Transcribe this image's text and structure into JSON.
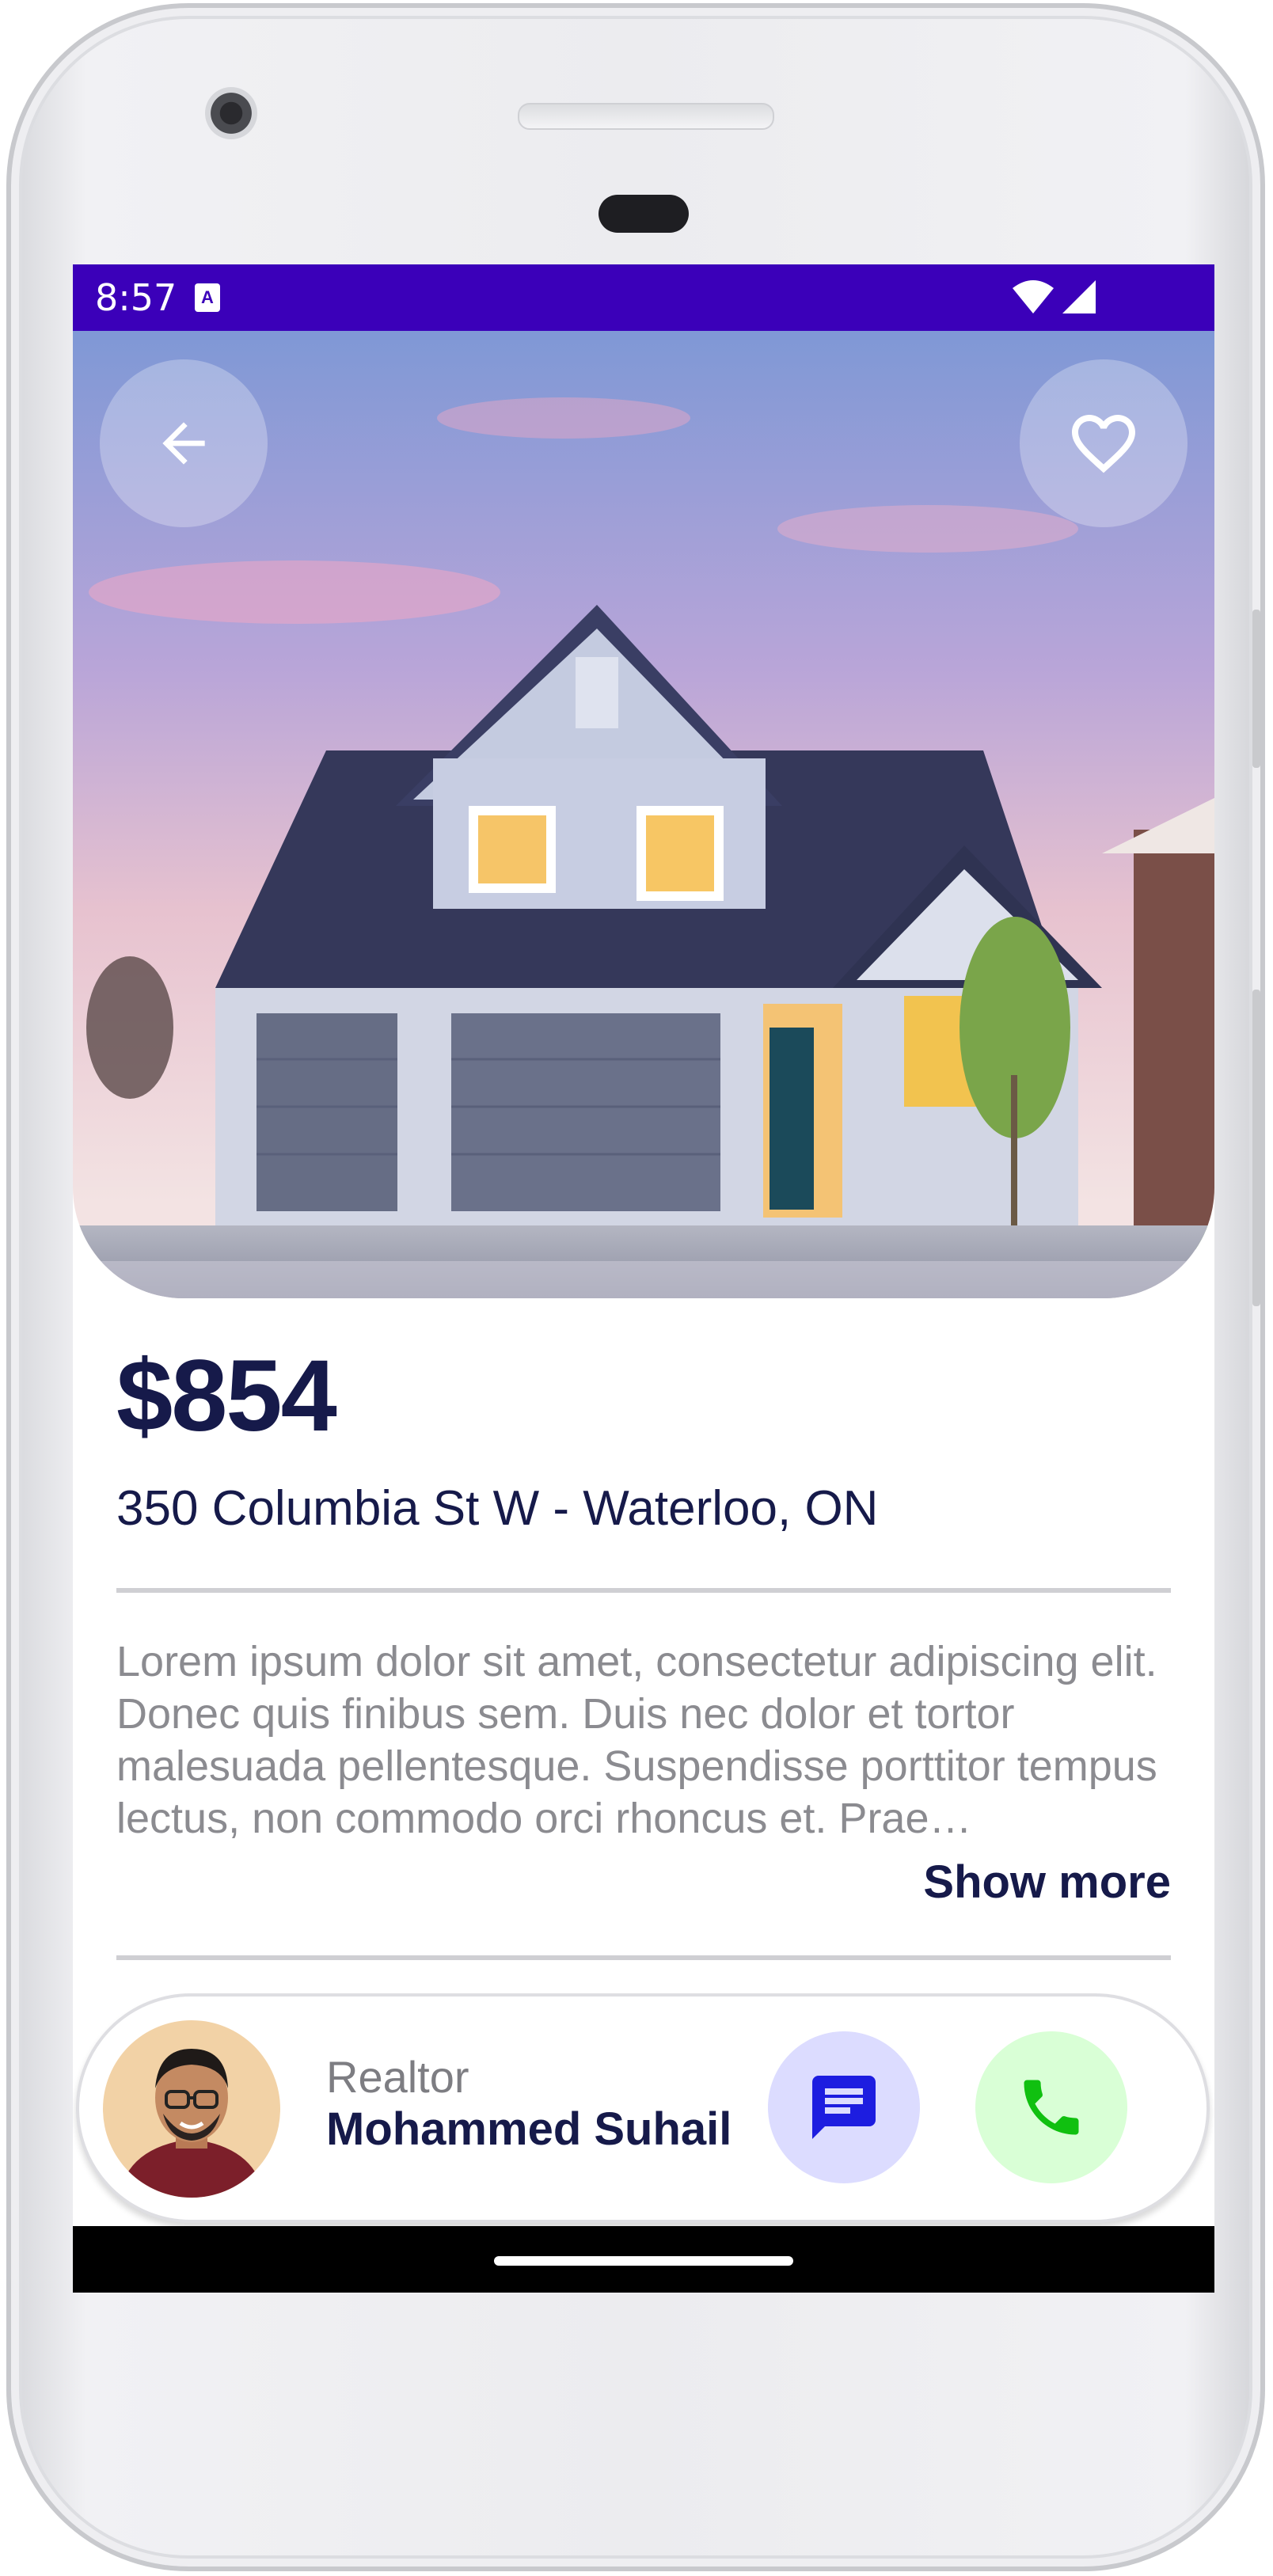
{
  "status_bar": {
    "time": "8:57",
    "background_color": "#3b00b9",
    "icons": [
      "accessibility-a-icon",
      "wifi-icon",
      "cell-signal-icon"
    ]
  },
  "hero": {
    "image_description_name": "house-photo",
    "back_icon": "arrow-left-icon",
    "favorite_icon": "heart-outline-icon"
  },
  "listing": {
    "price": "$854",
    "address": "350 Columbia St W - Waterloo, ON",
    "description": "Lorem ipsum dolor sit amet, consectetur adipiscing elit. Donec quis finibus sem. Duis nec dolor et tortor malesuada pellentesque. Suspendisse porttitor tempus lectus, non commodo orci rhoncus et. Prae…",
    "show_more_label": "Show more"
  },
  "realtor": {
    "role": "Realtor",
    "name": "Mohammed Suhail",
    "message_icon": "chat-message-icon",
    "call_icon": "phone-icon"
  },
  "colors": {
    "primary_text": "#161a4a",
    "secondary_text": "#8b8b90",
    "message_button_bg": "#dcdcff",
    "message_icon": "#1d1de0",
    "call_button_bg": "#d9ffd6",
    "call_icon": "#10c010"
  }
}
